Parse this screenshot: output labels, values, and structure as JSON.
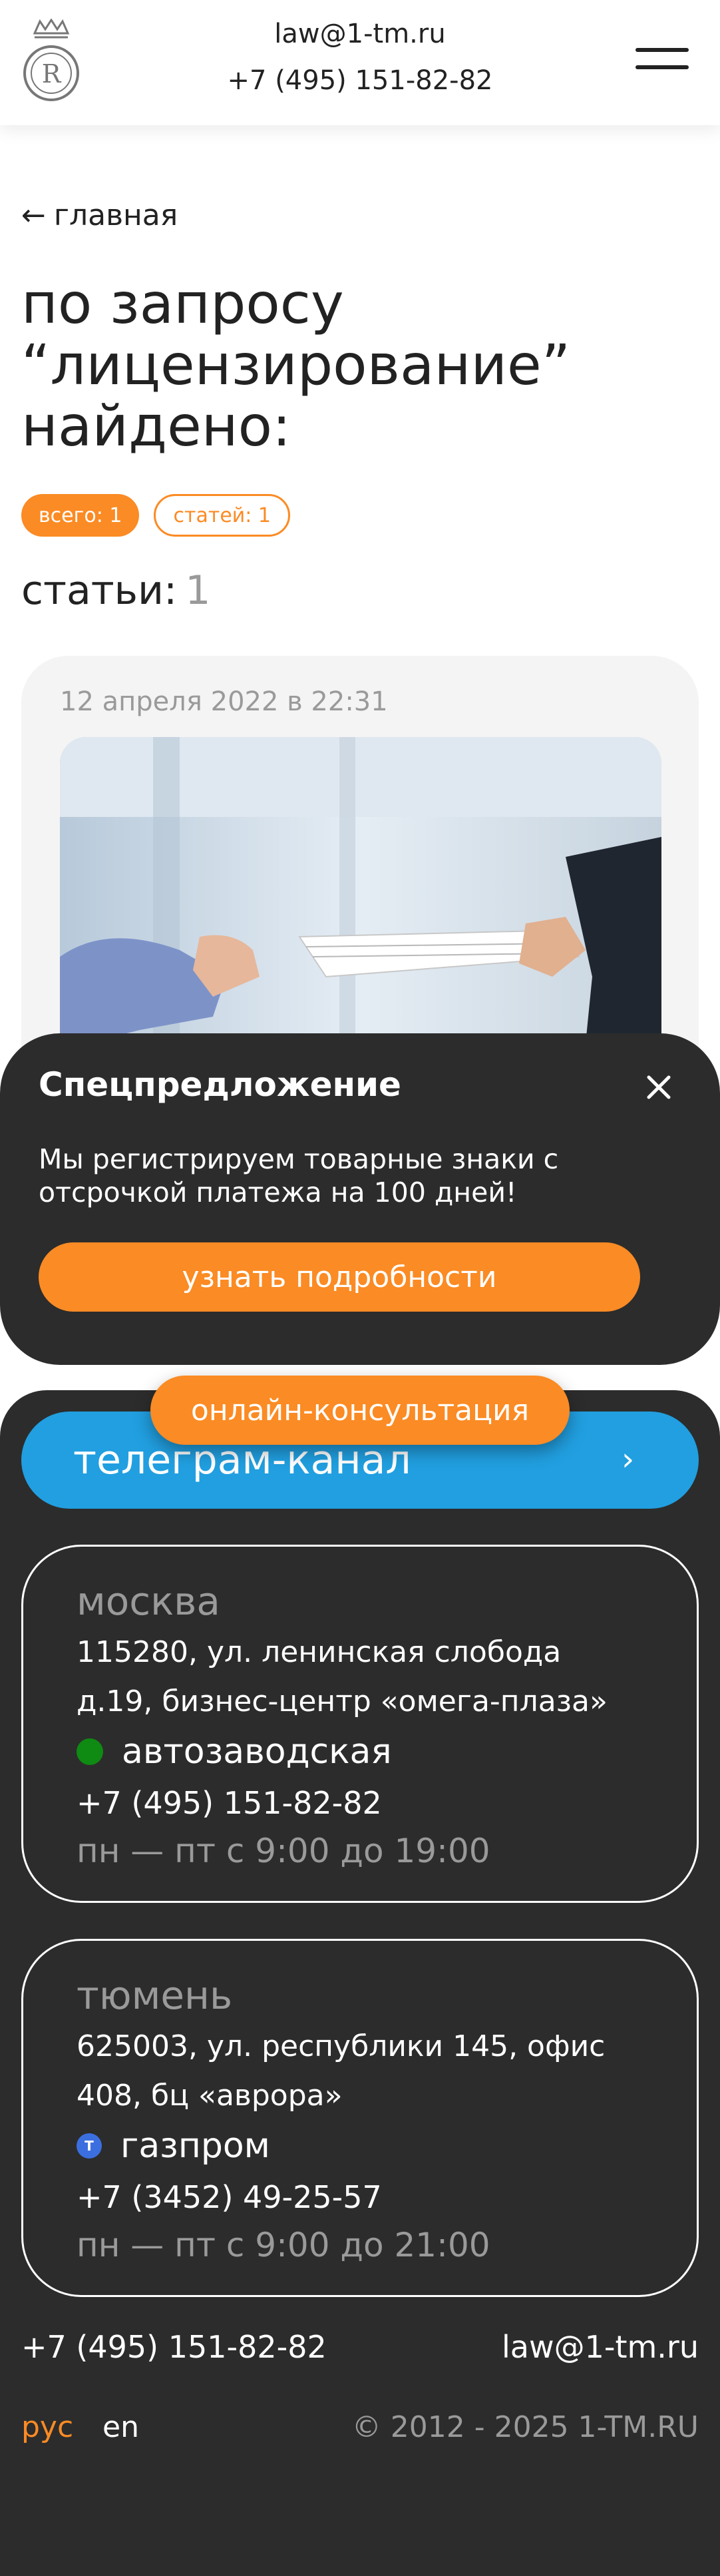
{
  "header": {
    "email": "law@1-tm.ru",
    "phone": "+7 (495) 151-82-82",
    "logo_letter": "R"
  },
  "main": {
    "back_label": "главная",
    "title": "по запросу “лицензирование” найдено:",
    "chips": {
      "total": "всего: 1",
      "articles": "статей: 1"
    },
    "section_title": "статьи:",
    "section_count": "1",
    "article": {
      "date": "12 апреля 2022 в 22:31"
    }
  },
  "popup": {
    "title": "Спецпредложение",
    "text": "Мы регистрируем товарные знаки с отсрочкой платежа на 100 дней!",
    "button": "узнать подробности"
  },
  "consult_button": "онлайн-консультация",
  "footer": {
    "telegram": "телеграм-канал",
    "offices": [
      {
        "city": "москва",
        "address": "115280, ул. ленинская слобода д.19, бизнес-центр «омега-плаза»",
        "metro": "автозаводская",
        "phone": "+7 (495) 151-82-82",
        "hours": "пн — пт с 9:00 до 19:00"
      },
      {
        "city": "тюмень",
        "address": "625003, ул. республики 145, офис 408, бц «аврора»",
        "metro": "газпром",
        "metro_badge": "Т",
        "phone": "+7 (3452) 49-25-57",
        "hours": "пн — пт с 9:00 до 21:00"
      }
    ],
    "phone": "+7 (495) 151-82-82",
    "email": "law@1-tm.ru",
    "lang_ru": "рус",
    "lang_en": "en",
    "copyright": "© 2012 - 2025 1-TM.RU"
  },
  "colors": {
    "accent": "#fb8b24",
    "dark": "#2c2c2c",
    "telegram": "#219fe0",
    "metro_moscow": "#0f8a12",
    "metro_tyumen": "#3b6fe0"
  }
}
